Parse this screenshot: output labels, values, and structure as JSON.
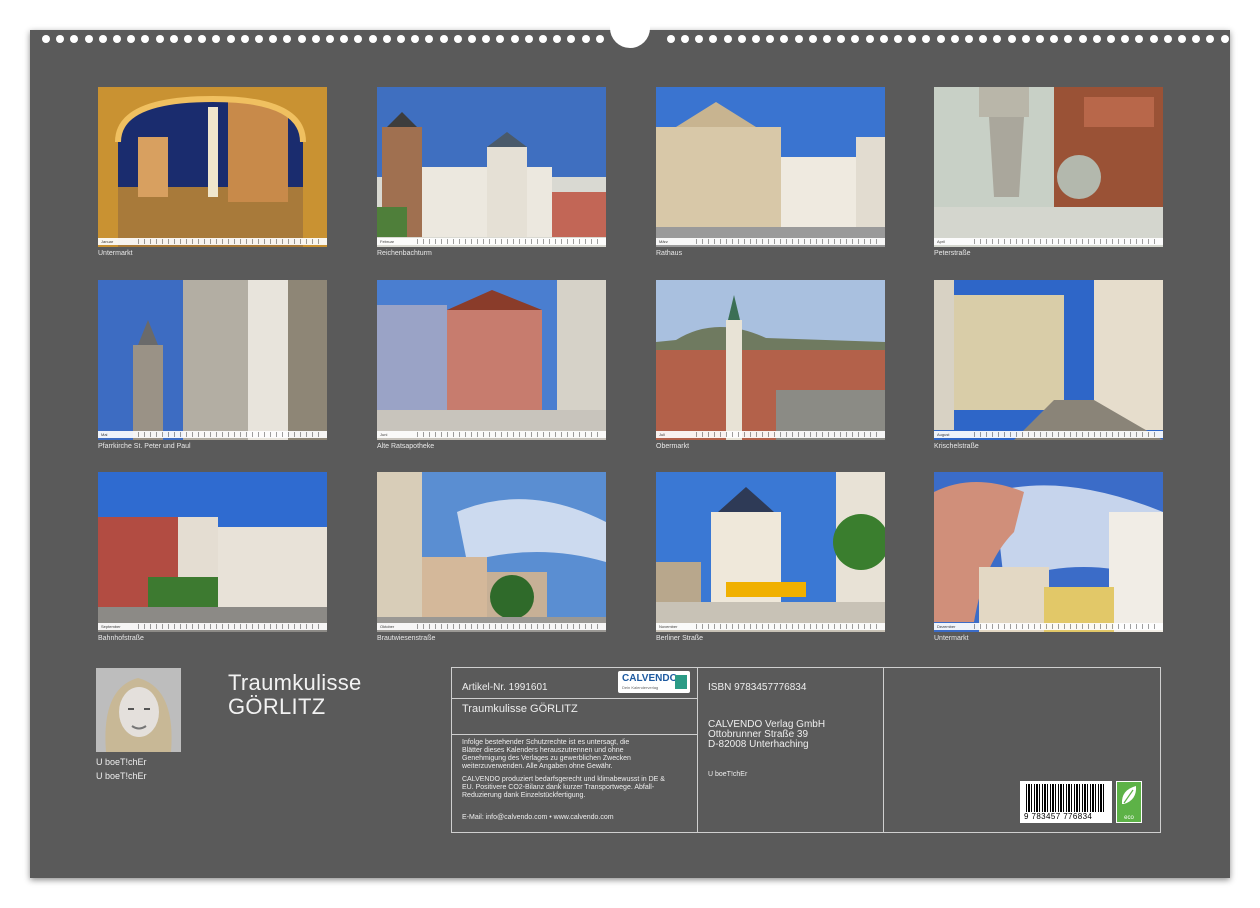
{
  "calendar_pages": [
    {
      "caption": "Untermarkt",
      "month": "Januar"
    },
    {
      "caption": "Reichenbachturm",
      "month": "Februar"
    },
    {
      "caption": "Rathaus",
      "month": "März"
    },
    {
      "caption": "Peterstraße",
      "month": "April"
    },
    {
      "caption": "Pfarrkirche St. Peter und Paul",
      "month": "Mai"
    },
    {
      "caption": "Alte Ratsapotheke",
      "month": "Juni"
    },
    {
      "caption": "Obermarkt",
      "month": "Juli"
    },
    {
      "caption": "Krischelstraße",
      "month": "August"
    },
    {
      "caption": "Bahnhofstraße",
      "month": "September"
    },
    {
      "caption": "Brautwiesenstraße",
      "month": "Oktober"
    },
    {
      "caption": "Berliner Straße",
      "month": "November"
    },
    {
      "caption": "Untermarkt",
      "month": "Dezember"
    }
  ],
  "author": {
    "line1": "U boeT!chEr",
    "line2": "U boeT!chEr"
  },
  "title": {
    "line1": "Traumkulisse",
    "line2": "GÖRLITZ"
  },
  "info": {
    "article": "Artikel-Nr. 1991601",
    "logo": "CALVENDO",
    "logo_sub": "Dein Kalenderverlag",
    "product_title": "Traumkulisse GÖRLITZ",
    "legal1": "Infolge bestehender Schutzrechte ist es untersagt, die\nBlätter dieses Kalenders herauszutrennen und ohne\nGenehmigung des Verlages zu gewerblichen Zwecken\nweiterzuverwenden. Alle Angaben ohne Gewähr.",
    "legal2": "CALVENDO produziert bedarfsgerecht und klimabewusst in DE &\nEU. Positivere CO2-Bilanz dank kurzer Transportwege. Abfall-\nReduzierung dank Einzelstückfertigung.",
    "contact": "E-Mail: info@calvendo.com • www.calvendo.com",
    "isbn": "ISBN 9783457776834",
    "publisher": "CALVENDO Verlag GmbH\nOttobrunner Straße 39\nD-82008 Unterhaching",
    "author_small": "U boeT!chEr",
    "barcode_digits": "9 783457 776834",
    "eco_label": "eco"
  }
}
